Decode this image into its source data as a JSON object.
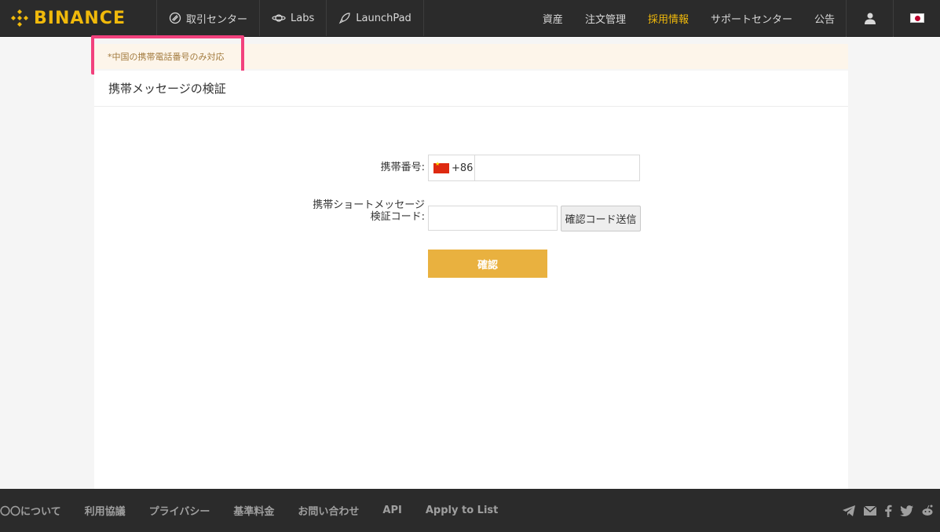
{
  "colors": {
    "header_bg": "#2b2b2b",
    "brand": "#f0b90b",
    "confirm": "#e9b13f",
    "notice_bg": "#fdf5ea",
    "notice_text": "#a27a3d",
    "highlight": "#f2417d"
  },
  "header": {
    "logo_text": "BINANCE",
    "nav_left": [
      {
        "label": "取引センター",
        "icon": "exchange-icon"
      },
      {
        "label": "Labs",
        "icon": "planet-icon"
      },
      {
        "label": "LaunchPad",
        "icon": "rocket-icon"
      }
    ],
    "nav_right": [
      {
        "label": "資産"
      },
      {
        "label": "注文管理"
      },
      {
        "label": "採用情報"
      },
      {
        "label": "サポートセンター"
      },
      {
        "label": "公告"
      }
    ]
  },
  "notice": {
    "text": "*中国の携帯電話番号のみ対応"
  },
  "card": {
    "title": "携帯メッセージの検証",
    "phone_label": "携帯番号:",
    "country_code": "+86",
    "phone_value": "",
    "sms_label_line1": "携帯ショートメッセージ",
    "sms_label_line2": "検証コード:",
    "code_value": "",
    "send_code_label": "確認コード送信",
    "confirm_label": "確認"
  },
  "footer": {
    "links": [
      {
        "label": "〇〇について"
      },
      {
        "label": "利用協議"
      },
      {
        "label": "プライバシー"
      },
      {
        "label": "基準料金"
      },
      {
        "label": "お問い合わせ"
      },
      {
        "label": "API"
      },
      {
        "label": "Apply to List"
      }
    ],
    "social_icons": [
      "telegram-icon",
      "mail-icon",
      "facebook-icon",
      "twitter-icon",
      "reddit-icon"
    ]
  }
}
